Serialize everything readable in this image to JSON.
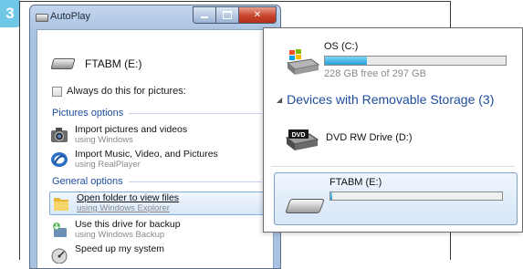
{
  "step_number": "3",
  "autoplay": {
    "title": "AutoPlay",
    "drive_label": "FTABM (E:)",
    "always_checkbox_label": "Always do this for pictures:",
    "always_checked": false,
    "pictures_section": "Pictures options",
    "general_section": "General options",
    "options": [
      {
        "title": "Import pictures and videos",
        "subtitle": "using Windows",
        "icon": "camera-icon"
      },
      {
        "title": "Import Music, Video, and Pictures",
        "subtitle": "using RealPlayer",
        "icon": "realplayer-icon"
      },
      {
        "title": "Open folder to view files",
        "subtitle": "using Windows Explorer",
        "icon": "folder-icon",
        "selected": true
      },
      {
        "title": "Use this drive for backup",
        "subtitle": "using Windows Backup",
        "icon": "backup-icon"
      },
      {
        "title": "Speed up my system",
        "subtitle": "",
        "icon": "speed-icon"
      }
    ]
  },
  "computer": {
    "os_drive": {
      "label": "OS (C:)",
      "free_text": "228 GB free of 297 GB",
      "used_fraction": 0.23
    },
    "group_header": "Devices with Removable Storage (3)",
    "dvd_drive": {
      "label": "DVD RW Drive (D:)",
      "badge": "DVD"
    },
    "usb_drive": {
      "label": "FTABM (E:)",
      "used_fraction": 0.01
    }
  },
  "colors": {
    "accent_blue": "#1e4c9a",
    "badge_blue": "#6fc7e8",
    "usage_bar": "#2aa0d6"
  }
}
